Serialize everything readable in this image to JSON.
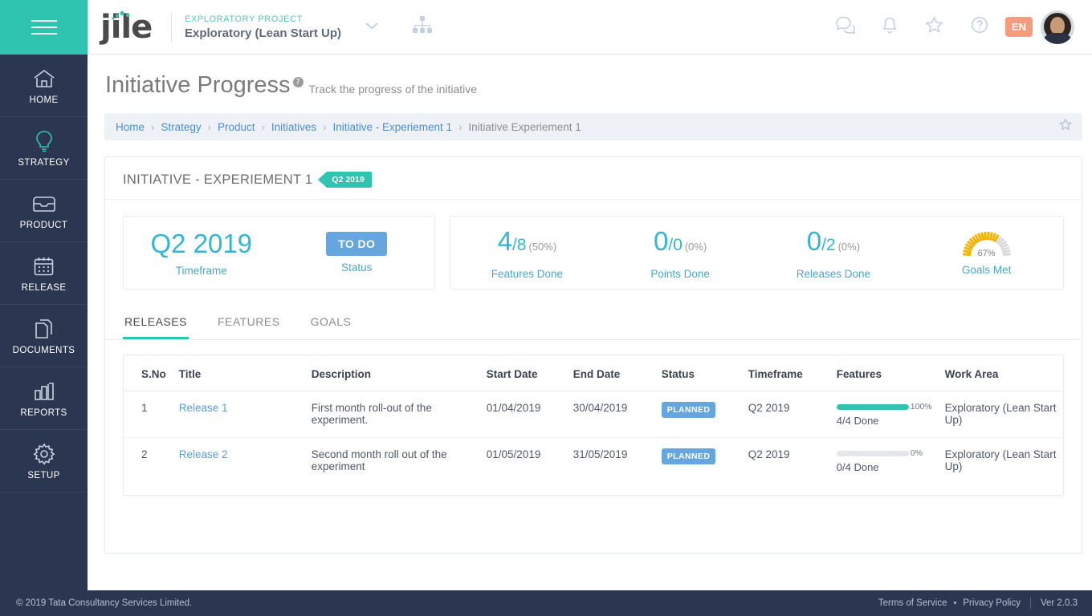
{
  "sidebar": {
    "menu_icon": "hamburger-icon",
    "items": [
      {
        "label": "HOME",
        "icon": "home-icon"
      },
      {
        "label": "STRATEGY",
        "icon": "lightbulb-icon"
      },
      {
        "label": "PRODUCT",
        "icon": "inbox-icon"
      },
      {
        "label": "RELEASE",
        "icon": "calendar-icon"
      },
      {
        "label": "DOCUMENTS",
        "icon": "documents-icon"
      },
      {
        "label": "REPORTS",
        "icon": "bar-chart-icon"
      },
      {
        "label": "SETUP",
        "icon": "gear-icon"
      }
    ]
  },
  "topbar": {
    "logo_text": "jile",
    "project_kicker": "EXPLORATORY PROJECT",
    "project_name": "Exploratory (Lean Start Up)",
    "chevron_icon": "chevron-down-icon",
    "hierarchy_icon": "org-chart-icon",
    "icons": [
      "chat-icon",
      "bell-icon",
      "star-icon",
      "help-icon"
    ],
    "language": "EN",
    "avatar": "user-avatar"
  },
  "page": {
    "title": "Initiative Progress",
    "help": "?",
    "subtitle": "Track the progress of the initiative"
  },
  "breadcrumb": {
    "items": [
      {
        "label": "Home",
        "current": false
      },
      {
        "label": "Strategy",
        "current": false
      },
      {
        "label": "Product",
        "current": false
      },
      {
        "label": "Initiatives",
        "current": false
      },
      {
        "label": "Initiative - Experiement 1",
        "current": false
      },
      {
        "label": "Initiative Experiement 1",
        "current": true
      }
    ],
    "separator": "›",
    "favorite_icon": "star-outline-icon"
  },
  "panel": {
    "title": "INITIATIVE - EXPERIEMENT 1",
    "timeframe_flag": "Q2 2019"
  },
  "stats": {
    "timeframe": {
      "value": "Q2 2019",
      "label": "Timeframe"
    },
    "status": {
      "value": "TO DO",
      "label": "Status"
    },
    "features_done": {
      "num": "4",
      "den": "/8",
      "pct": "(50%)",
      "label": "Features Done"
    },
    "points_done": {
      "num": "0",
      "den": "/0",
      "pct": "(0%)",
      "label": "Points Done"
    },
    "releases_done": {
      "num": "0",
      "den": "/2",
      "pct": "(0%)",
      "label": "Releases Done"
    },
    "goals_met": {
      "value": "67%",
      "percent": 67,
      "label": "Goals Met"
    }
  },
  "tabs": [
    {
      "label": "RELEASES",
      "active": true
    },
    {
      "label": "FEATURES",
      "active": false
    },
    {
      "label": "GOALS",
      "active": false
    }
  ],
  "table": {
    "columns": [
      "S.No",
      "Title",
      "Description",
      "Start Date",
      "End Date",
      "Status",
      "Timeframe",
      "Features",
      "Work Area"
    ],
    "rows": [
      {
        "sno": "1",
        "title": "Release 1",
        "description": "First month roll-out of the experiment.",
        "start_date": "01/04/2019",
        "end_date": "30/04/2019",
        "status": "PLANNED",
        "timeframe": "Q2 2019",
        "features_pct": "100%",
        "features_pct_value": 100,
        "features_done": "4/4 Done",
        "work_area": "Exploratory (Lean Start Up)"
      },
      {
        "sno": "2",
        "title": "Release 2",
        "description": "Second month roll out of the experiment",
        "start_date": "01/05/2019",
        "end_date": "31/05/2019",
        "status": "PLANNED",
        "timeframe": "Q2 2019",
        "features_pct": "0%",
        "features_pct_value": 0,
        "features_done": "0/4 Done",
        "work_area": "Exploratory (Lean Start Up)"
      }
    ]
  },
  "footer": {
    "copyright": "© 2019 Tata Consultancy Services Limited.",
    "terms": "Terms of Service",
    "dot": "•",
    "privacy": "Privacy Policy",
    "version": "Ver 2.0.3"
  },
  "colors": {
    "teal": "#2ec4b0",
    "navy": "#2b3750",
    "blue_badge": "#64a6dd",
    "cyan_stat": "#32b6d4",
    "orange": "#f79b7e",
    "gauge_orange": "#f5b301",
    "gauge_gray": "#d8dade"
  }
}
